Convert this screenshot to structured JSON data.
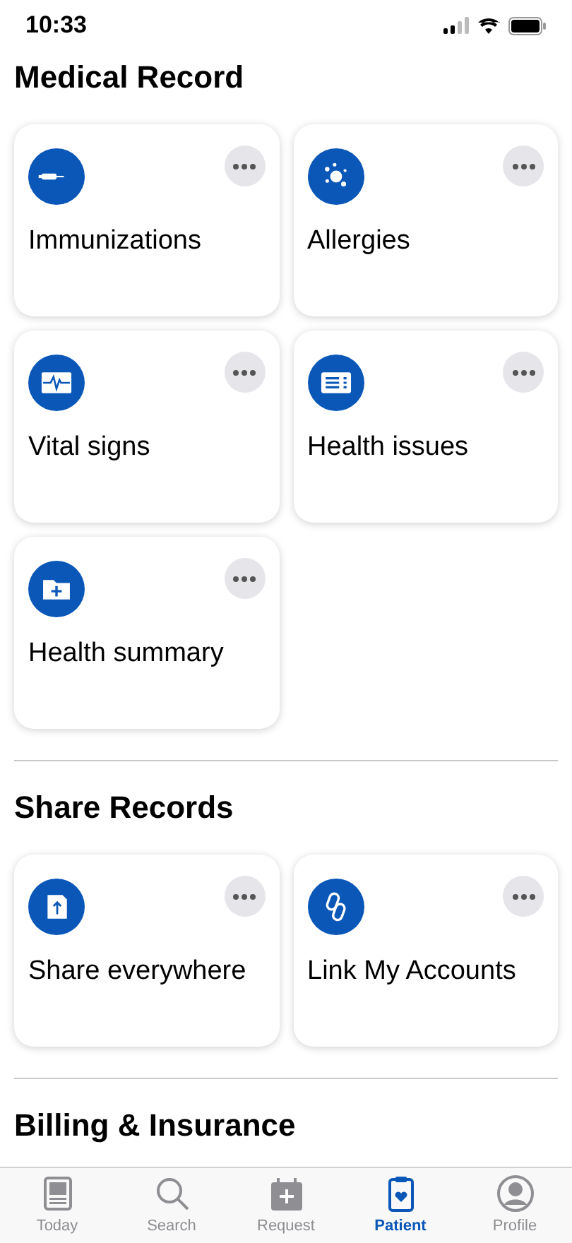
{
  "status_bar": {
    "time": "10:33"
  },
  "sections": [
    {
      "title": "Medical Record",
      "cards": [
        {
          "label": "Immunizations",
          "kind": "syringe"
        },
        {
          "label": "Allergies",
          "kind": "allergen"
        },
        {
          "label": "Vital signs",
          "kind": "pulse"
        },
        {
          "label": "Health issues",
          "kind": "list"
        },
        {
          "label": "Health summary",
          "kind": "folder"
        }
      ]
    },
    {
      "title": "Share Records",
      "cards": [
        {
          "label": "Share everywhere",
          "kind": "upload"
        },
        {
          "label": "Link My Accounts",
          "kind": "link"
        }
      ]
    },
    {
      "title": "Billing & Insurance"
    }
  ],
  "tab_bar": [
    {
      "label": "Today",
      "kind": "today",
      "selected": false
    },
    {
      "label": "Search",
      "kind": "search",
      "selected": false
    },
    {
      "label": "Request",
      "kind": "request",
      "selected": false
    },
    {
      "label": "Patient",
      "kind": "patient",
      "selected": true
    },
    {
      "label": "Profile",
      "kind": "profile",
      "selected": false
    }
  ]
}
